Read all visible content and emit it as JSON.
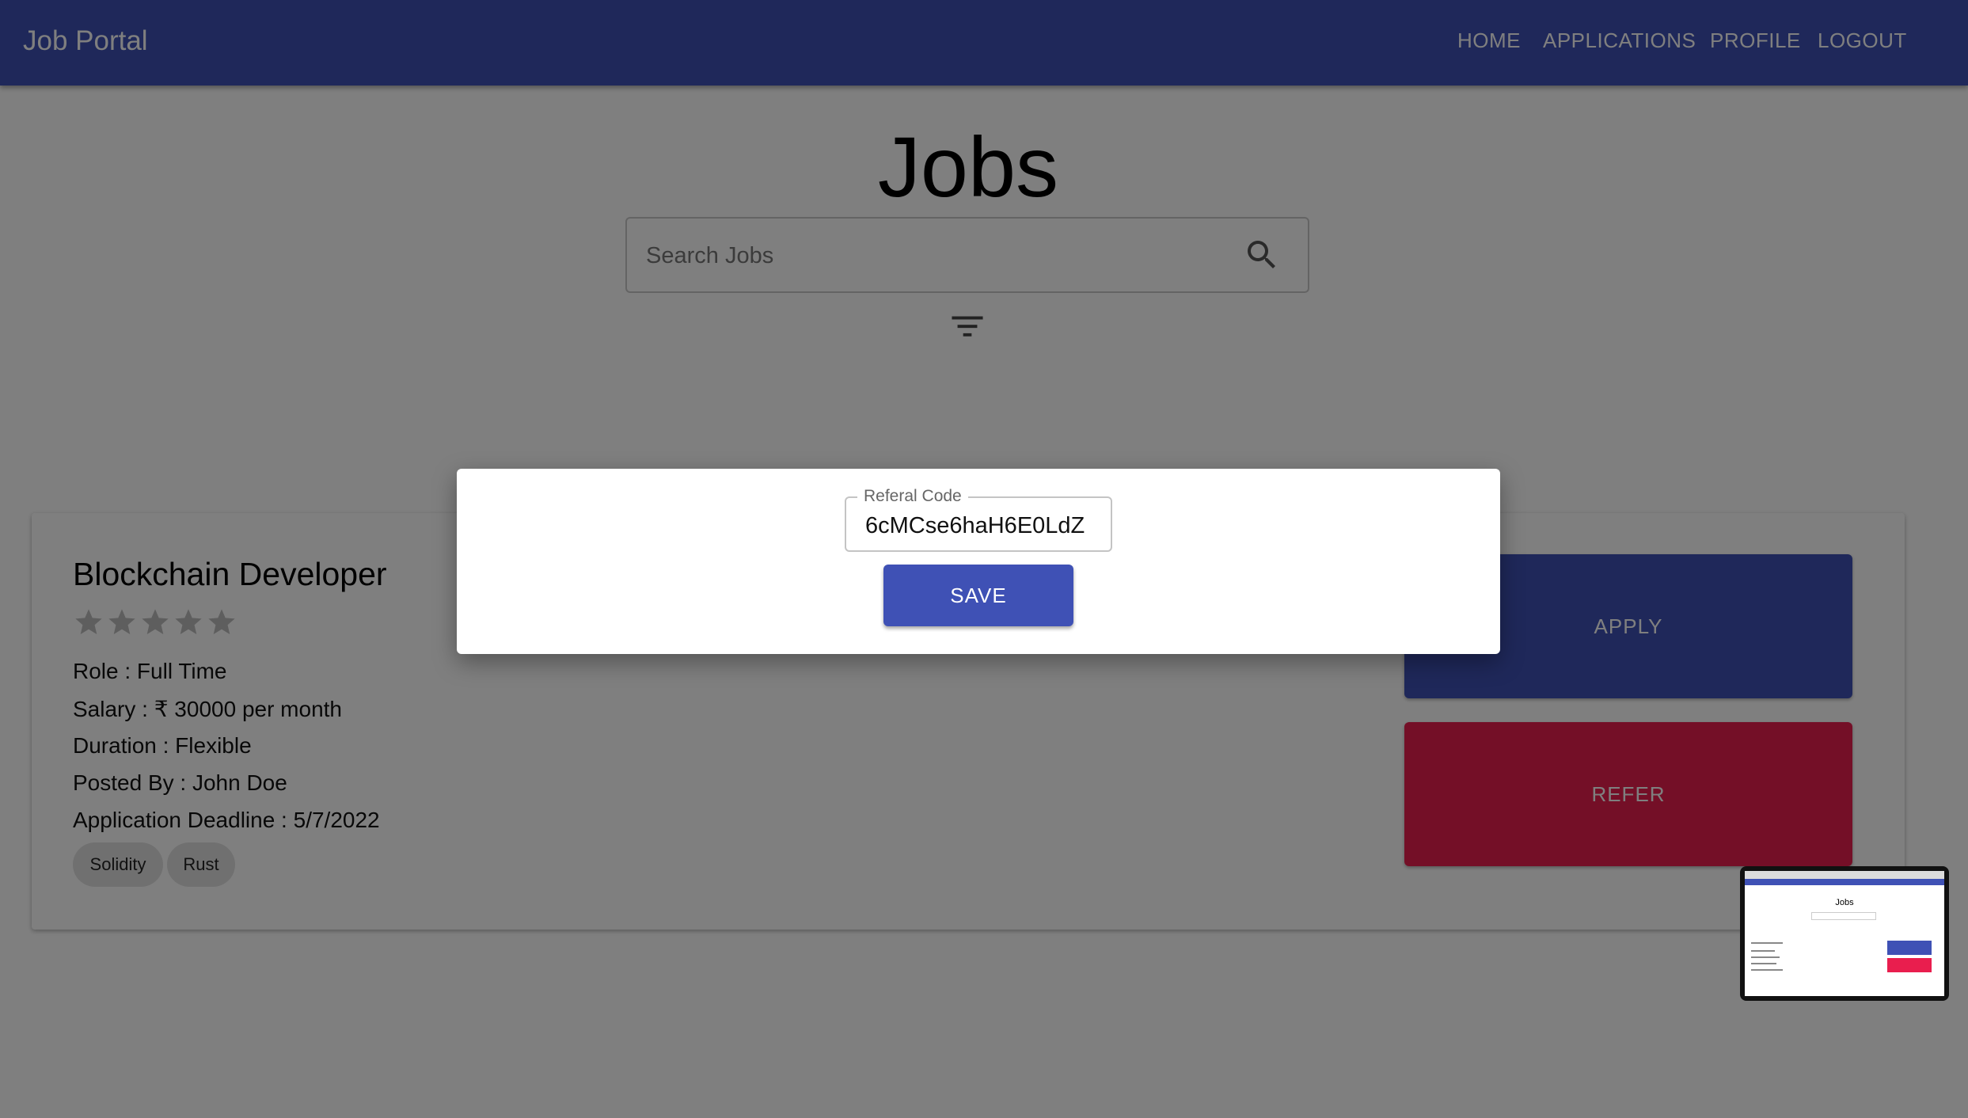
{
  "app": {
    "title": "Job Portal"
  },
  "nav": {
    "items": [
      "HOME",
      "APPLICATIONS",
      "PROFILE",
      "LOGOUT"
    ]
  },
  "page": {
    "title": "Jobs"
  },
  "search": {
    "placeholder": "Search Jobs",
    "value": ""
  },
  "icons": {
    "search": "search-icon",
    "filter": "filter-icon",
    "star": "star-icon"
  },
  "job": {
    "title": "Blockchain Developer",
    "rating": 0,
    "rating_max": 5,
    "role": "Role : Full Time",
    "salary": "Salary : ₹ 30000 per month",
    "duration": "Duration : Flexible",
    "posted_by": "Posted By : John Doe",
    "deadline": "Application Deadline : 5/7/2022",
    "skills": [
      "Solidity",
      "Rust"
    ],
    "apply_label": "APPLY",
    "refer_label": "REFER"
  },
  "modal": {
    "field_label": "Referal Code",
    "field_value": "6cMCse6haH6E0LdZ",
    "save_label": "SAVE"
  },
  "colors": {
    "primary": "#3f51b5",
    "secondary": "#e91e4e",
    "backdrop": "rgba(0,0,0,0.5)",
    "chip": "#e0e0e0"
  }
}
